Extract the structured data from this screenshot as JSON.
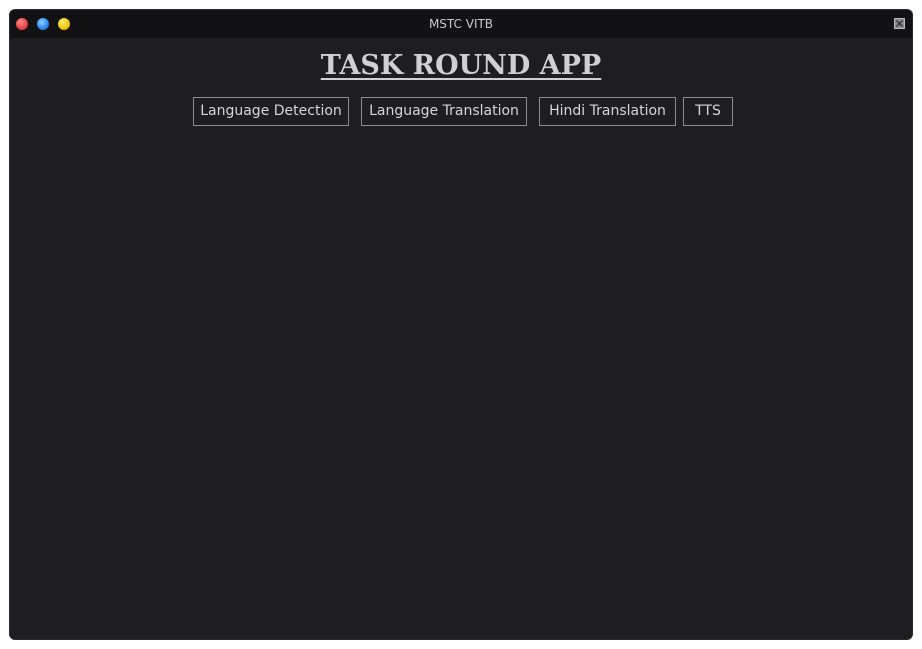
{
  "window": {
    "title": "MSTC VITB"
  },
  "app": {
    "heading": "TASK ROUND APP"
  },
  "buttons": [
    {
      "label": "Language Detection"
    },
    {
      "label": "Language Translation"
    },
    {
      "label": "Hindi Translation"
    },
    {
      "label": "TTS"
    }
  ]
}
